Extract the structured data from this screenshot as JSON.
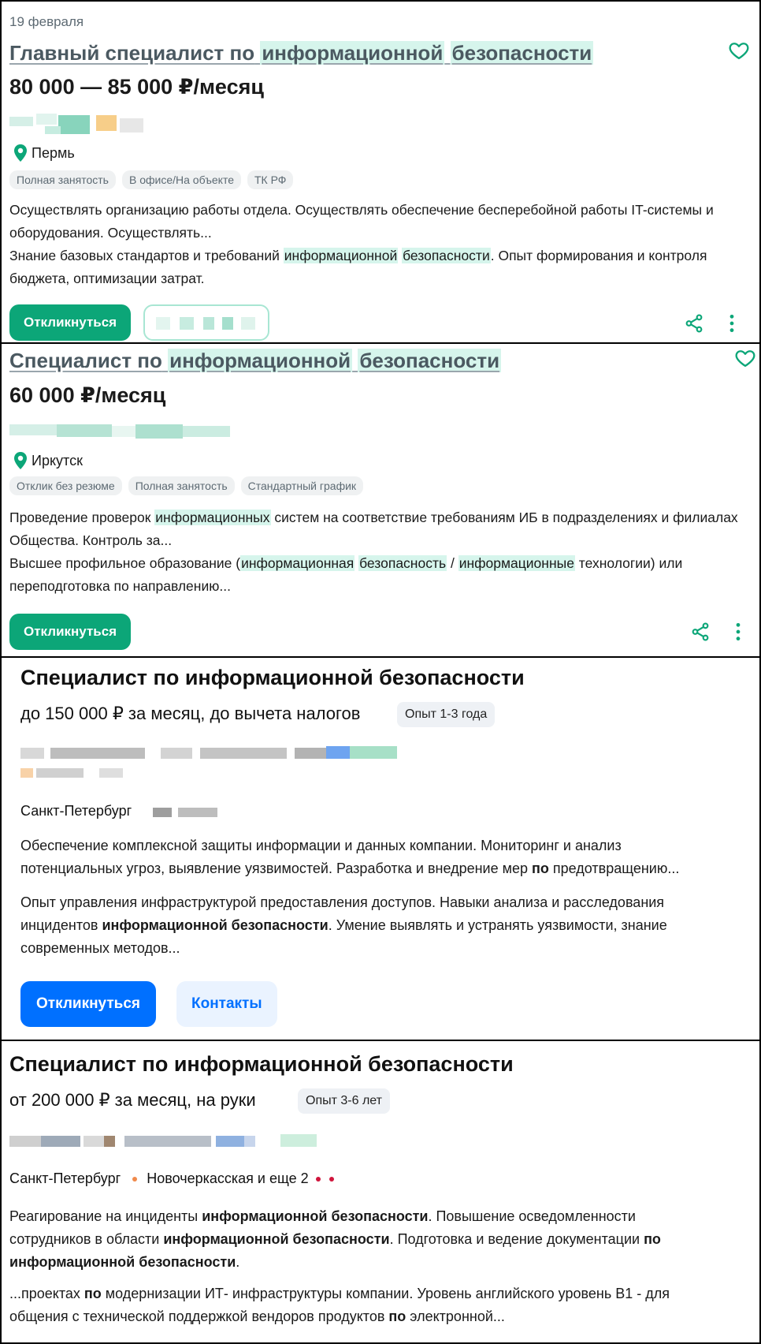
{
  "card1": {
    "date": "19 февраля",
    "title_prefix": "Главный специалист по",
    "title_hl1": "информационной",
    "title_hl2": "безопасности",
    "salary": "80 000 — 85 000 ₽/месяц",
    "city": "Пермь",
    "tags": [
      "Полная занятость",
      "В офисе/На объекте",
      "ТК РФ"
    ],
    "desc_line1": "Осуществлять организацию работы отдела. Осуществлять обеспечение бесперебойной работы IT-системы и",
    "desc_line2": "оборудования. Осуществлять...",
    "desc_line3_a": "Знание базовых стандартов и требований",
    "desc_line3_hl1": "информационной",
    "desc_line3_hl2": "безопасности",
    "desc_line3_b": ". Опыт формирования и контроля",
    "desc_line4": "бюджета, оптимизации затрат.",
    "respond_label": "Откликнуться",
    "icons": {
      "favorite": "heart-outline-icon",
      "share": "share-icon",
      "more": "more-vertical-icon",
      "location": "map-pin-icon"
    }
  },
  "card2": {
    "title_prefix": "Специалист по",
    "title_hl1": "информационной",
    "title_hl2": "безопасности",
    "salary": "60 000 ₽/месяц",
    "city": "Иркутск",
    "tags": [
      "Отклик без резюме",
      "Полная занятость",
      "Стандартный график"
    ],
    "desc_line1_a": "Проведение проверок",
    "desc_line1_hl": "информационных",
    "desc_line1_b": "систем на соответствие требованиям ИБ в подразделениях и филиалах",
    "desc_line2": "Общества. Контроль за...",
    "desc_line3_a": "Высшее профильное образование (",
    "desc_line3_hl1": "информационная",
    "desc_line3_hl2": "безопасность",
    "desc_line3_sep": " / ",
    "desc_line3_hl3": "информационные",
    "desc_line3_b": " технологии) или",
    "desc_line4": "переподготовка по направлению...",
    "respond_label": "Откликнуться"
  },
  "card3": {
    "title": "Специалист по информационной безопасности",
    "salary": "до 150 000 ₽ за месяц, до вычета налогов",
    "experience": "Опыт 1-3 года",
    "city": "Санкт-Петербург",
    "desc1_line1": "Обеспечение комплексной защиты информации и данных компании. Мониторинг и анализ",
    "desc1_line2_a": "потенциальных угроз, выявление уязвимостей. Разработка и внедрение мер ",
    "desc1_line2_bold": "по",
    "desc1_line2_b": " предотвращению...",
    "desc2_line1": "Опыт управления инфраструктурой предоставления доступов. Навыки анализа и расследования",
    "desc2_line2_a": "инцидентов ",
    "desc2_line2_bold": "информационной безопасности",
    "desc2_line2_b": ". Умение выявлять и устранять уязвимости, знание",
    "desc2_line3": "современных методов...",
    "respond_label": "Откликнуться",
    "contacts_label": "Контакты"
  },
  "card4": {
    "title": "Специалист по информационной безопасности",
    "salary": "от 200 000 ₽ за месяц, на руки",
    "experience": "Опыт 3-6 лет",
    "city": "Санкт-Петербург",
    "metro": "Новочеркасская и еще 2",
    "desc1_line1_a": "Реагирование на инциденты ",
    "desc1_line1_bold": "информационной безопасности",
    "desc1_line1_b": ". Повышение осведомленности",
    "desc1_line2_a": "сотрудников в области ",
    "desc1_line2_bold": "информационной безопасности",
    "desc1_line2_b": ". Подготовка и ведение документации ",
    "desc1_line2_bold2": "по",
    "desc1_line3_bold": "информационной безопасности",
    "desc1_line3_b": ".",
    "desc2_line1_a": "...проектах ",
    "desc2_line1_bold": "по",
    "desc2_line1_b": " модернизации ИТ- инфраструктуры компании. Уровень английского уровень B1 - для",
    "desc2_line2_a": "общения с технической поддержкой вендоров продуктов ",
    "desc2_line2_bold": "по",
    "desc2_line2_b": " электронной..."
  },
  "colors": {
    "accent_green": "#0ca678",
    "highlight": "#d6f5ec",
    "accent_blue": "#0070ff",
    "metro_orange": "#f08a4b",
    "metro_red": "#d0153c"
  }
}
